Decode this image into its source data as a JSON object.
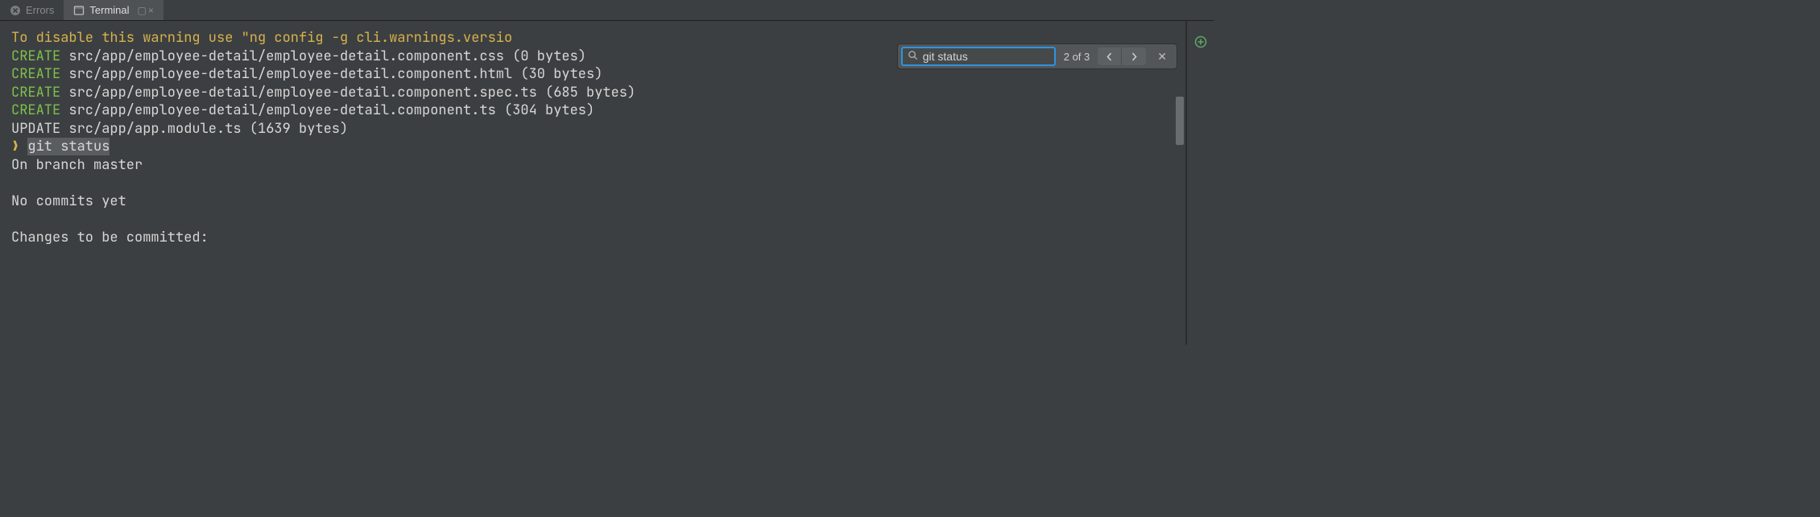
{
  "tabs": {
    "errors_label": "Errors",
    "terminal_label": "Terminal"
  },
  "search": {
    "value": "git status",
    "count": "2 of 3"
  },
  "terminal": {
    "warning": "To disable this warning use \"ng config -g cli.warnings.versio",
    "create_word": "CREATE",
    "update_word": "UPDATE",
    "line_css": " src/app/employee-detail/employee-detail.component.css (0 bytes)",
    "line_html": " src/app/employee-detail/employee-detail.component.html (30 bytes)",
    "line_spec": " src/app/employee-detail/employee-detail.component.spec.ts (685 bytes)",
    "line_ts": " src/app/employee-detail/employee-detail.component.ts (304 bytes)",
    "line_upd": " src/app/app.module.ts (1639 bytes)",
    "prompt_char": "❯",
    "prompt_cmd": "git status",
    "branch": "On branch master",
    "nocommits": "No commits yet",
    "changes": "Changes to be committed:"
  }
}
